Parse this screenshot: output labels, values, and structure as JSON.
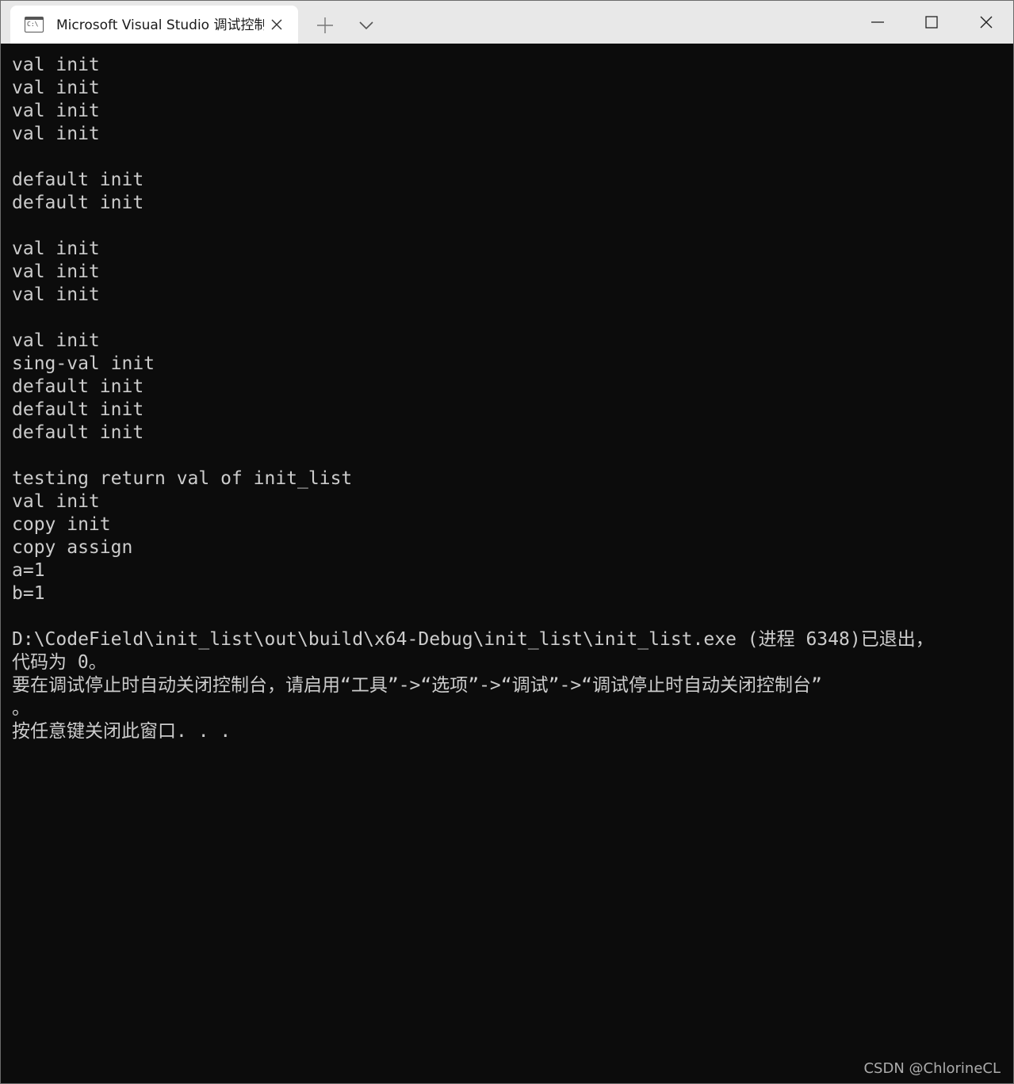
{
  "window": {
    "tab_title": "Microsoft Visual Studio 调试控制台",
    "tab_icon_text": "C:\\",
    "icons": {
      "tab_icon": "console-icon",
      "tab_close": "close-icon",
      "new_tab": "plus-icon",
      "dropdown": "chevron-down-icon",
      "minimize": "minimize-icon",
      "maximize": "maximize-icon",
      "close": "close-icon"
    }
  },
  "console": {
    "lines": [
      "val init",
      "val init",
      "val init",
      "val init",
      "",
      "default init",
      "default init",
      "",
      "val init",
      "val init",
      "val init",
      "",
      "val init",
      "sing-val init",
      "default init",
      "default init",
      "default init",
      "",
      "testing return val of init_list",
      "val init",
      "copy init",
      "copy assign",
      "a=1",
      "b=1",
      "",
      "D:\\CodeField\\init_list\\out\\build\\x64-Debug\\init_list\\init_list.exe (进程 6348)已退出，",
      "代码为 0。",
      "要在调试停止时自动关闭控制台，请启用“工具”->“选项”->“调试”->“调试停止时自动关闭控制台”",
      "。",
      "按任意键关闭此窗口. . ."
    ]
  },
  "watermark": "CSDN @ChlorineCL",
  "colors": {
    "console_bg": "#0c0c0c",
    "console_fg": "#cccccc",
    "titlebar_bg": "#e8e8e8",
    "tab_bg": "#ffffff"
  }
}
